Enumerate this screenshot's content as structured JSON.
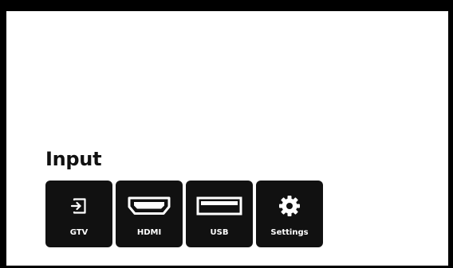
{
  "section": {
    "title": "Input"
  },
  "inputs": [
    {
      "label": "GTV",
      "icon": "input-arrow-icon"
    },
    {
      "label": "HDMI",
      "icon": "hdmi-port-icon"
    },
    {
      "label": "USB",
      "icon": "usb-port-icon"
    },
    {
      "label": "Settings",
      "icon": "gear-icon"
    }
  ],
  "colors": {
    "frame": "#000000",
    "background": "#ffffff",
    "tile": "#111111",
    "tile_text": "#ffffff",
    "title_text": "#111111"
  }
}
